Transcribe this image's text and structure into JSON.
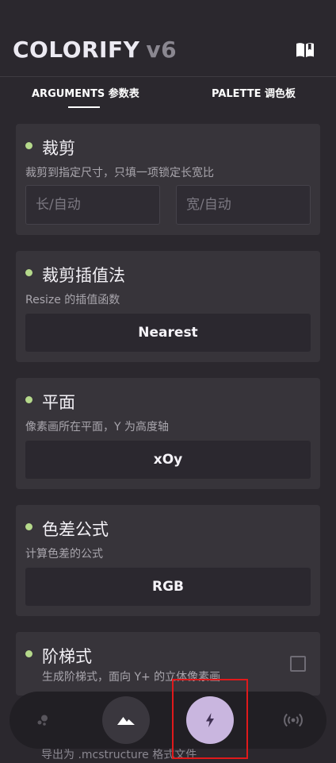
{
  "header": {
    "title": "COLORIFY",
    "version": "v6"
  },
  "tabs": [
    {
      "label": "ARGUMENTS 参数表"
    },
    {
      "label": "PALETTE 调色板"
    }
  ],
  "cards": {
    "crop": {
      "title": "裁剪",
      "description": "裁剪到指定尺寸，只填一项锁定长宽比",
      "length_placeholder": "长/自动",
      "width_placeholder": "宽/自动",
      "length_value": "",
      "width_value": ""
    },
    "interp": {
      "title": "裁剪插值法",
      "description": "Resize 的插值函数",
      "value": "Nearest"
    },
    "plane": {
      "title": "平面",
      "description": "像素画所在平面，Y 为高度轴",
      "value": "xOy"
    },
    "colordiff": {
      "title": "色差公式",
      "description": "计算色差的公式",
      "value": "RGB"
    },
    "stair": {
      "title": "阶梯式",
      "description": "生成阶梯式，面向 Y+ 的立体像素画",
      "checked": false
    }
  },
  "partial_text": "导出为 .mcstructure 格式文件",
  "colors": {
    "bg": "#2b282e",
    "card": "#37343a",
    "accent_dot": "#b5d98b",
    "active_nav": "#c9b6df",
    "highlight": "#e0191b"
  },
  "nav": [
    {
      "icon": "bubbles-icon",
      "active": false
    },
    {
      "icon": "mountain-icon",
      "active": false
    },
    {
      "icon": "bolt-icon",
      "active": true
    },
    {
      "icon": "broadcast-icon",
      "active": false
    }
  ]
}
